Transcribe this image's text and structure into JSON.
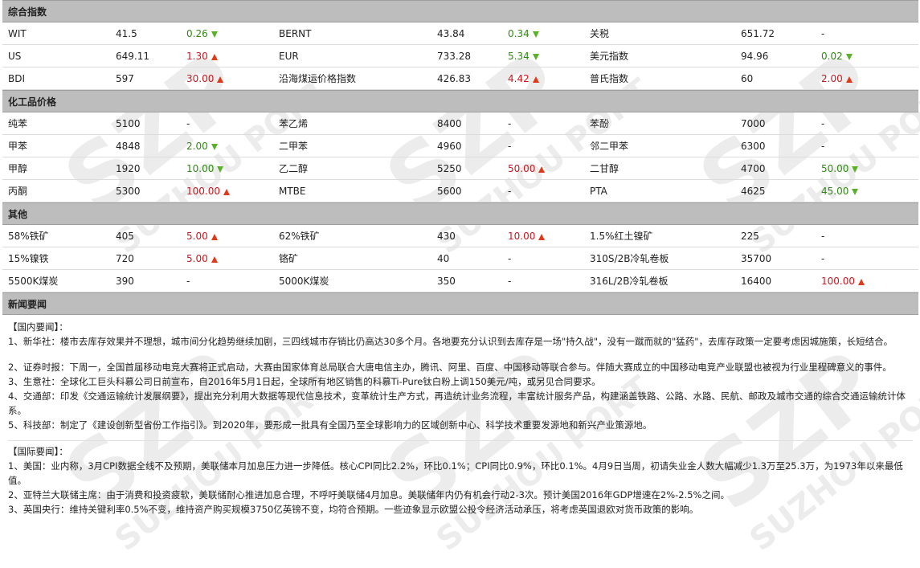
{
  "sections": {
    "composite": "综合指数",
    "chemicals": "化工品价格",
    "others": "其他",
    "news": "新闻要闻"
  },
  "composite_rows": [
    [
      {
        "name": "WIT",
        "value": "41.5",
        "change": "0.26",
        "dir": "down"
      },
      {
        "name": "BERNT",
        "value": "43.84",
        "change": "0.34",
        "dir": "down"
      },
      {
        "name": "关税",
        "value": "651.72",
        "change": "-",
        "dir": ""
      }
    ],
    [
      {
        "name": "US",
        "value": "649.11",
        "change": "1.30",
        "dir": "up"
      },
      {
        "name": "EUR",
        "value": "733.28",
        "change": "5.34",
        "dir": "down"
      },
      {
        "name": "美元指数",
        "value": "94.96",
        "change": "0.02",
        "dir": "down"
      }
    ],
    [
      {
        "name": "BDI",
        "value": "597",
        "change": "30.00",
        "dir": "up"
      },
      {
        "name": "沿海煤运价格指数",
        "value": "426.83",
        "change": "4.42",
        "dir": "up"
      },
      {
        "name": "普氏指数",
        "value": "60",
        "change": "2.00",
        "dir": "up"
      }
    ]
  ],
  "chemical_rows": [
    [
      {
        "name": "纯苯",
        "value": "5100",
        "change": "-",
        "dir": ""
      },
      {
        "name": "苯乙烯",
        "value": "8400",
        "change": "-",
        "dir": ""
      },
      {
        "name": "苯酚",
        "value": "7000",
        "change": "-",
        "dir": ""
      }
    ],
    [
      {
        "name": "甲苯",
        "value": "4848",
        "change": "2.00",
        "dir": "down"
      },
      {
        "name": "二甲苯",
        "value": "4960",
        "change": "-",
        "dir": ""
      },
      {
        "name": "邻二甲苯",
        "value": "6300",
        "change": "-",
        "dir": ""
      }
    ],
    [
      {
        "name": "甲醇",
        "value": "1920",
        "change": "10.00",
        "dir": "down"
      },
      {
        "name": "乙二醇",
        "value": "5250",
        "change": "50.00",
        "dir": "up"
      },
      {
        "name": "二甘醇",
        "value": "4700",
        "change": "50.00",
        "dir": "down"
      }
    ],
    [
      {
        "name": "丙酮",
        "value": "5300",
        "change": "100.00",
        "dir": "up"
      },
      {
        "name": "MTBE",
        "value": "5600",
        "change": "-",
        "dir": ""
      },
      {
        "name": "PTA",
        "value": "4625",
        "change": "45.00",
        "dir": "down"
      }
    ]
  ],
  "other_rows": [
    [
      {
        "name": "58%铁矿",
        "value": "405",
        "change": "5.00",
        "dir": "up"
      },
      {
        "name": "62%铁矿",
        "value": "430",
        "change": "10.00",
        "dir": "up"
      },
      {
        "name": "1.5%红土镍矿",
        "value": "225",
        "change": "-",
        "dir": ""
      }
    ],
    [
      {
        "name": "15%镍铁",
        "value": "720",
        "change": "5.00",
        "dir": "up"
      },
      {
        "name": "铬矿",
        "value": "40",
        "change": "-",
        "dir": ""
      },
      {
        "name": "310S/2B冷轧卷板",
        "value": "35700",
        "change": "-",
        "dir": ""
      }
    ],
    [
      {
        "name": "5500K煤炭",
        "value": "390",
        "change": "-",
        "dir": ""
      },
      {
        "name": "5000K煤炭",
        "value": "350",
        "change": "-",
        "dir": ""
      },
      {
        "name": "316L/2B冷轧卷板",
        "value": "16400",
        "change": "100.00",
        "dir": "up"
      }
    ]
  ],
  "news": {
    "domestic_label": "【国内要闻】：",
    "domestic": [
      "1、新华社：楼市去库存效果并不理想，城市间分化趋势继续加剧，三四线城市存销比仍高达30多个月。各地要充分认识到去库存是一场\"持久战\"，没有一蹴而就的\"猛药\"，去库存政策一定要考虑因城施策，长短结合。",
      "2、证券时报：下周一，全国首届移动电竞大赛将正式启动，大赛由国家体育总局联合大唐电信主办，腾讯、阿里、百度、中国移动等联合参与。伴随大赛成立的中国移动电竞产业联盟也被视为行业里程碑意义的事件。",
      "3、生意社：全球化工巨头科慕公司日前宣布，自2016年5月1日起，全球所有地区销售的科慕Ti-Pure钛白粉上调150美元/吨，或另见合同要求。",
      "4、交通部：印发《交通运输统计发展纲要》，提出充分利用大数据等现代信息技术，变革统计生产方式，再造统计业务流程，丰富统计服务产品，构建涵盖铁路、公路、水路、民航、邮政及城市交通的综合交通运输统计体系。",
      "5、科技部：制定了《建设创新型省份工作指引》。到2020年，要形成一批具有全国乃至全球影响力的区域创新中心、科学技术重要发源地和新兴产业策源地。"
    ],
    "international_label": "【国际要闻】：",
    "international": [
      "1、美国：业内称，3月CPI数据全线不及预期，美联储本月加息压力进一步降低。核心CPI同比2.2%，环比0.1%；CPI同比0.9%，环比0.1%。4月9日当周，初请失业金人数大幅减少1.3万至25.3万，为1973年以来最低值。",
      "2、亚特兰大联储主席：由于消费和投资疲软，美联储耐心推进加息合理，不呼吁美联储4月加息。美联储年内仍有机会行动2-3次。预计美国2016年GDP增速在2%-2.5%之间。",
      "3、英国央行：维持关键利率0.5%不变，维持资产购买规模3750亿英镑不变，均符合预期。一些迹象显示欧盟公投令经济活动承压，将考虑英国退欧对货币政策的影响。"
    ]
  },
  "watermark_text": "SUZHOU PORT",
  "watermark_logo": "SZP",
  "colors": {
    "up": "#c8161d",
    "down": "#2f8a12",
    "header_bg": "#bdbdbd"
  }
}
